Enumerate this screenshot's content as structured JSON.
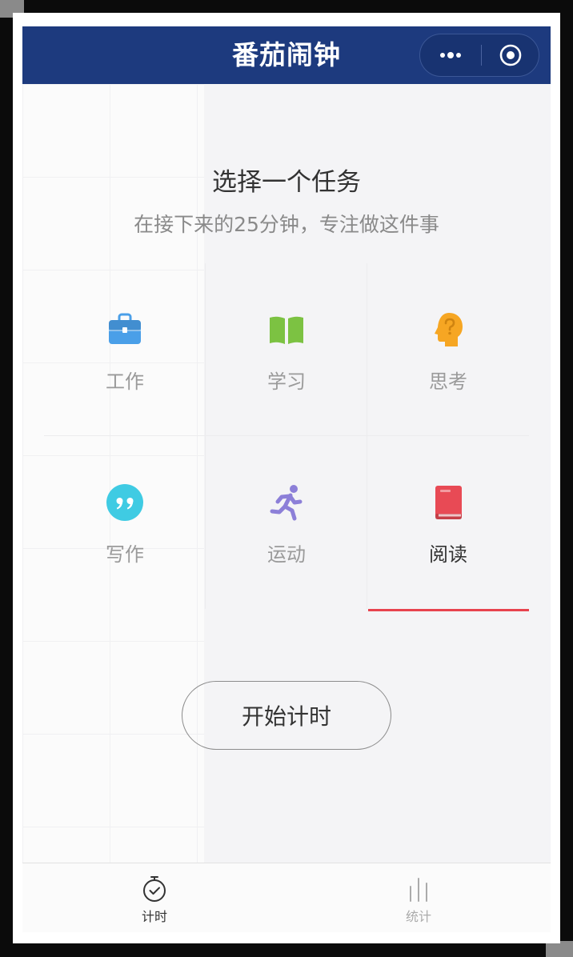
{
  "header": {
    "title": "番茄闹钟",
    "capsule": {
      "more_icon": "more-dots-icon",
      "exit_icon": "target-icon"
    }
  },
  "intro": {
    "heading": "选择一个任务",
    "subheading": "在接下来的25分钟，专注做这件事"
  },
  "tasks": [
    {
      "label": "工作",
      "icon": "briefcase-icon",
      "color": "#4a9fe8",
      "selected": false
    },
    {
      "label": "学习",
      "icon": "open-book-icon",
      "color": "#7cc242",
      "selected": false
    },
    {
      "label": "思考",
      "icon": "thinking-head-icon",
      "color": "#f6a623",
      "selected": false
    },
    {
      "label": "写作",
      "icon": "quote-icon",
      "color": "#3fcbe3",
      "selected": false
    },
    {
      "label": "运动",
      "icon": "runner-icon",
      "color": "#8c7fd8",
      "selected": false
    },
    {
      "label": "阅读",
      "icon": "red-book-icon",
      "color": "#e84a55",
      "selected": true
    }
  ],
  "start_button": {
    "label": "开始计时"
  },
  "tabbar": {
    "tabs": [
      {
        "label": "计时",
        "icon": "stopwatch-icon",
        "active": true
      },
      {
        "label": "统计",
        "icon": "bar-chart-icon",
        "active": false
      }
    ]
  },
  "colors": {
    "navbar": "#1d3a7e",
    "accent": "#e8434e"
  }
}
